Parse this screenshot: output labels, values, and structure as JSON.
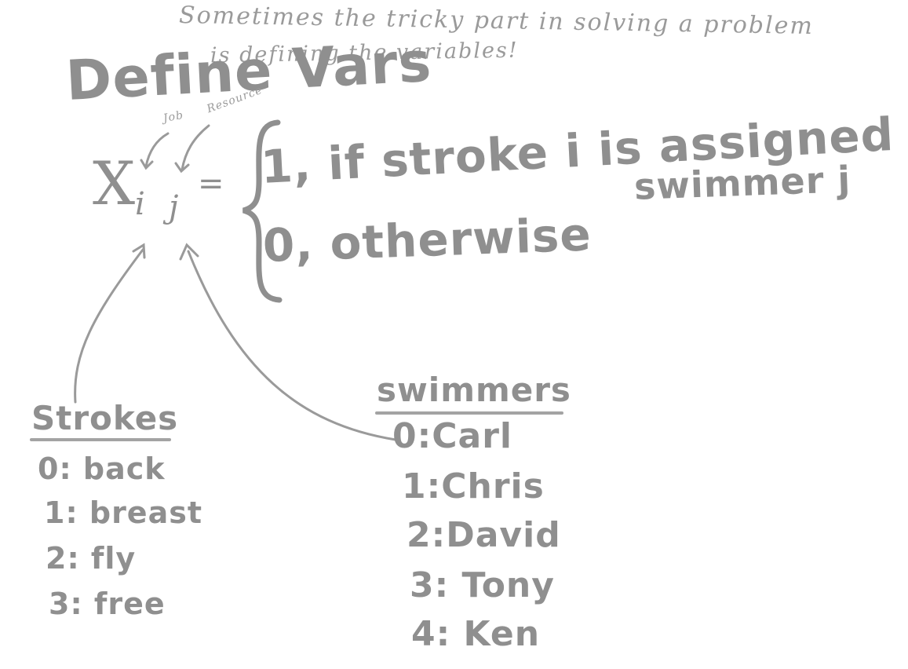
{
  "note": {
    "line1": "Sometimes the tricky part in solving a problem",
    "line2": "is defining the variables!"
  },
  "title": "Define Vars",
  "labels": {
    "job": "Job",
    "resource": "Resource"
  },
  "variable": {
    "symbol": "X",
    "index_i": "i",
    "index_j": "j",
    "equals": "="
  },
  "cases": {
    "case1_line1": "1, if stroke i is assigned",
    "case1_line2": "swimmer j",
    "case0": "0, otherwise"
  },
  "strokes": {
    "heading": "Strokes",
    "items": [
      "0: back",
      "1: breast",
      "2: fly",
      "3: free"
    ]
  },
  "swimmers": {
    "heading": "swimmers",
    "items": [
      "0:Carl",
      "1:Chris",
      "2:David",
      "3: Tony",
      "4: Ken"
    ]
  },
  "colors": {
    "ink": "#8c8c8c",
    "paper": "#ffffff"
  }
}
